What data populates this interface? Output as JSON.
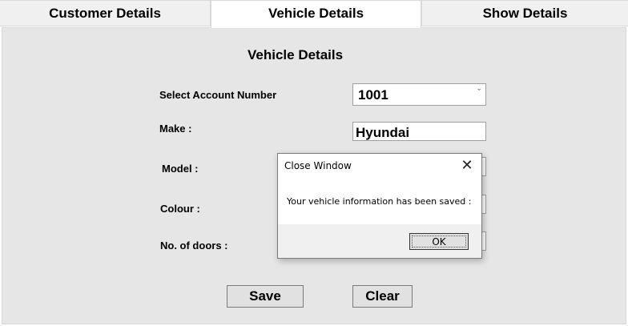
{
  "tabs": [
    {
      "label": "Customer Details"
    },
    {
      "label": "Vehicle Details"
    },
    {
      "label": "Show Details"
    }
  ],
  "form": {
    "heading": "Vehicle Details",
    "account_label": "Select Account Number",
    "account_value": "1001",
    "make_label": "Make :",
    "make_value": "Hyundai",
    "model_label": "Model :",
    "colour_label": "Colour :",
    "doors_label": "No. of doors :",
    "save_label": "Save",
    "clear_label": "Clear"
  },
  "dialog": {
    "title": "Close Window",
    "message": "Your vehicle information has been saved :",
    "ok_label": "OK"
  }
}
